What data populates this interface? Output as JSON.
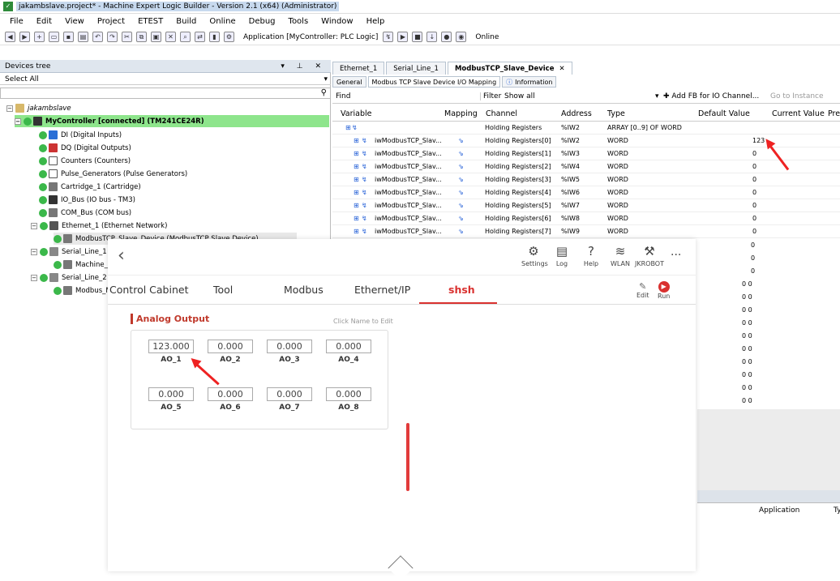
{
  "window": {
    "title": "jakambslave.project* - Machine Expert Logic Builder - Version 2.1 (x64) (Administrator)"
  },
  "menu": [
    "File",
    "Edit",
    "View",
    "Project",
    "ETEST",
    "Build",
    "Online",
    "Debug",
    "Tools",
    "Window",
    "Help"
  ],
  "toolbar": {
    "application": "Application [MyController: PLC Logic]",
    "status": "Online"
  },
  "devices": {
    "title": "Devices tree",
    "select_all": "Select All",
    "nodes": [
      "jakambslave",
      "MyController [connected] (TM241CE24R)",
      "DI (Digital Inputs)",
      "DQ (Digital Outputs)",
      "Counters (Counters)",
      "Pulse_Generators (Pulse Generators)",
      "Cartridge_1 (Cartridge)",
      "IO_Bus (IO bus - TM3)",
      "COM_Bus (COM bus)",
      "Ethernet_1 (Ethernet Network)",
      "ModbusTCP_Slave_Device (ModbusTCP Slave Device)",
      "Serial_Line_1 (",
      "Machine_E",
      "Serial_Line_2 (",
      "Modbus_M"
    ]
  },
  "editor": {
    "tabs": [
      "Ethernet_1",
      "Serial_Line_1",
      "ModbusTCP_Slave_Device"
    ],
    "subtabs": [
      "General",
      "Modbus TCP Slave Device I/O Mapping",
      "Information"
    ],
    "find": "Find",
    "filter": "Filter",
    "show_all": "Show all",
    "add_fb": "Add FB for IO Channel...",
    "goto": "Go to Instance",
    "columns": [
      "Variable",
      "Mapping",
      "Channel",
      "Address",
      "Type",
      "Default Value",
      "Current Value",
      "Pre"
    ],
    "rows": [
      {
        "var": "",
        "channel": "Holding Registers",
        "addr": "%IW2",
        "type": "ARRAY [0..9] OF WORD",
        "cur": ""
      },
      {
        "var": "iwModbusTCP_Slav...",
        "channel": "Holding Registers[0]",
        "addr": "%IW2",
        "type": "WORD",
        "cur": "123"
      },
      {
        "var": "iwModbusTCP_Slav...",
        "channel": "Holding Registers[1]",
        "addr": "%IW3",
        "type": "WORD",
        "cur": "0"
      },
      {
        "var": "iwModbusTCP_Slav...",
        "channel": "Holding Registers[2]",
        "addr": "%IW4",
        "type": "WORD",
        "cur": "0"
      },
      {
        "var": "iwModbusTCP_Slav...",
        "channel": "Holding Registers[3]",
        "addr": "%IW5",
        "type": "WORD",
        "cur": "0"
      },
      {
        "var": "iwModbusTCP_Slav...",
        "channel": "Holding Registers[4]",
        "addr": "%IW6",
        "type": "WORD",
        "cur": "0"
      },
      {
        "var": "iwModbusTCP_Slav...",
        "channel": "Holding Registers[5]",
        "addr": "%IW7",
        "type": "WORD",
        "cur": "0"
      },
      {
        "var": "iwModbusTCP_Slav...",
        "channel": "Holding Registers[6]",
        "addr": "%IW8",
        "type": "WORD",
        "cur": "0"
      },
      {
        "var": "iwModbusTCP_Slav...",
        "channel": "Holding Registers[7]",
        "addr": "%IW9",
        "type": "WORD",
        "cur": "0"
      }
    ],
    "extra_values": [
      "0",
      "0",
      "0",
      "0 0",
      "0 0",
      "0 0",
      "0 0",
      "0 0",
      "0 0",
      "0 0",
      "0 0",
      "0 0",
      "0 0",
      "0 0"
    ],
    "lower": {
      "application": "Application",
      "ty": "Ty"
    }
  },
  "app": {
    "icons": [
      {
        "name": "settings",
        "label": "Settings",
        "glyph": "⚙"
      },
      {
        "name": "log",
        "label": "Log",
        "glyph": "▤"
      },
      {
        "name": "help",
        "label": "Help",
        "glyph": "?"
      },
      {
        "name": "wlan",
        "label": "WLAN",
        "glyph": "≋"
      },
      {
        "name": "jkrobot",
        "label": "JKROBOT",
        "glyph": "⚒"
      }
    ],
    "more": "···",
    "tabs": [
      "Control Cabinet",
      "Tool",
      "Modbus",
      "Ethernet/IP",
      "shsh"
    ],
    "active_tab": "shsh",
    "edit": "Edit",
    "run": "Run",
    "section": "Analog Output",
    "hint": "Click Name to Edit",
    "outputs": [
      {
        "v": "123.000",
        "n": "AO_1"
      },
      {
        "v": "0.000",
        "n": "AO_2"
      },
      {
        "v": "0.000",
        "n": "AO_3"
      },
      {
        "v": "0.000",
        "n": "AO_4"
      },
      {
        "v": "0.000",
        "n": "AO_5"
      },
      {
        "v": "0.000",
        "n": "AO_6"
      },
      {
        "v": "0.000",
        "n": "AO_7"
      },
      {
        "v": "0.000",
        "n": "AO_8"
      }
    ],
    "colors": {
      "accent": "#d9312f",
      "controller_highlight": "#8ee58c"
    }
  }
}
